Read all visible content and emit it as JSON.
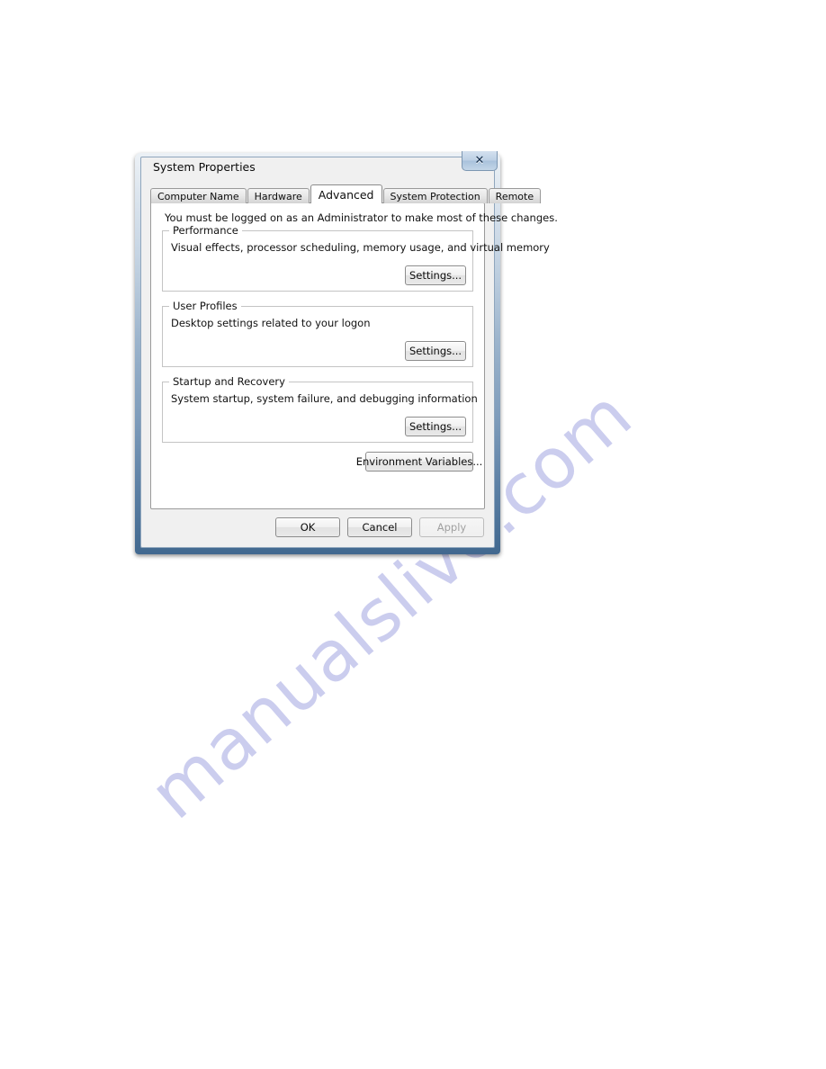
{
  "page": {
    "watermark_text": "manualslive.com",
    "watermark_color": "#c9cbee",
    "background_color": "#ffffff"
  },
  "window": {
    "title": "System Properties",
    "close_icon": "close-icon",
    "close_glyph": "✕"
  },
  "tabs": [
    {
      "label": "Computer Name",
      "selected": false
    },
    {
      "label": "Hardware",
      "selected": false
    },
    {
      "label": "Advanced",
      "selected": true
    },
    {
      "label": "System Protection",
      "selected": false
    },
    {
      "label": "Remote",
      "selected": false
    }
  ],
  "advanced": {
    "admin_notice": "You must be logged on as an Administrator to make most of these changes.",
    "groups": [
      {
        "legend": "Performance",
        "description": "Visual effects, processor scheduling, memory usage, and virtual memory",
        "button_label": "Settings..."
      },
      {
        "legend": "User Profiles",
        "description": "Desktop settings related to your logon",
        "button_label": "Settings..."
      },
      {
        "legend": "Startup and Recovery",
        "description": "System startup, system failure, and debugging information",
        "button_label": "Settings..."
      }
    ],
    "environment_variables_label": "Environment Variables..."
  },
  "command_buttons": {
    "ok_label": "OK",
    "cancel_label": "Cancel",
    "apply_label": "Apply",
    "apply_disabled": true
  }
}
